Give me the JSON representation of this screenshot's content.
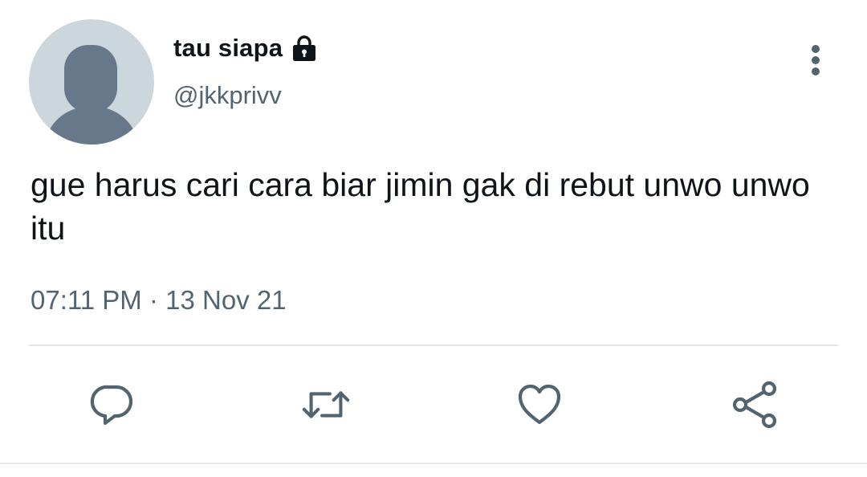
{
  "tweet": {
    "display_name": "tau siapa",
    "handle": "@jkkprivv",
    "locked": true,
    "text": "gue harus cari cara biar jimin gak di rebut unwo unwo itu",
    "time": "07:11 PM",
    "separator": "·",
    "date": "13 Nov 21"
  },
  "icons": {
    "avatar": "default-avatar-icon",
    "lock": "lock-icon",
    "more": "more-vertical-icon",
    "reply": "reply-icon",
    "retweet": "retweet-icon",
    "like": "heart-icon",
    "share": "share-icon"
  },
  "colors": {
    "text_primary": "#0f1419",
    "text_secondary": "#536471",
    "icon": "#536471",
    "avatar_bg": "#ccd6dd",
    "avatar_fg": "#66788a",
    "divider": "#e4e8eb"
  }
}
